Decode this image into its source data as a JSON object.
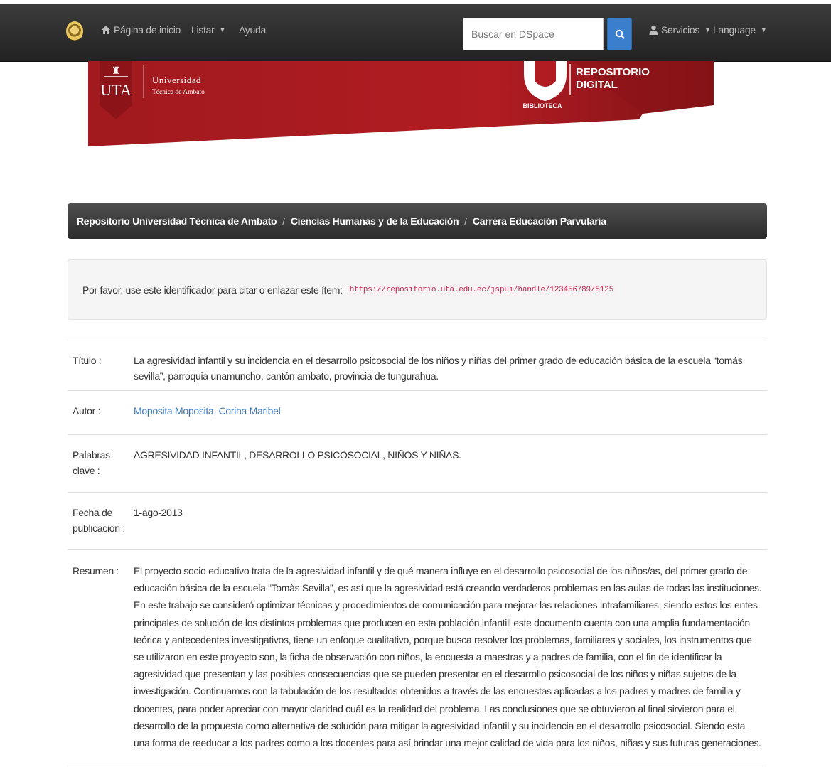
{
  "nav": {
    "home_label": "Página de inicio",
    "list_label": "Listar",
    "help_label": "Ayuda",
    "search_placeholder": "Buscar en DSpace",
    "services_label": "Servicios",
    "language_label": "Language"
  },
  "banner": {
    "uta_short": "UTA",
    "university_line1": "Universidad",
    "university_line2": "Técnica de Ambato",
    "repo_line1": "REPOSITORIO",
    "repo_line2": "DIGITAL",
    "library_label": "BIBLIOTECA",
    "colors": {
      "primary": "#a11a1e",
      "dark": "#6e0f12"
    }
  },
  "breadcrumb": {
    "items": [
      "Repositorio Universidad Técnica de Ambato",
      "Ciencias Humanas y de la Educación",
      "Carrera Educación Parvularia"
    ],
    "separator": "/"
  },
  "cite": {
    "label": "Por favor, use este identificador para citar o enlazar este ítem:",
    "uri": "https://repositorio.uta.edu.ec/jspui/handle/123456789/5125"
  },
  "metadata": {
    "title_label": "Título :",
    "title_value": "La agresividad infantil y su incidencia en el desarrollo psicosocial de los niños y niñas del primer grado de educación básica de la escuela “tomás sevilla”, parroquia unamuncho, cantón ambato, provincia de tungurahua.",
    "author_label": "Autor :",
    "author_value": "Moposita Moposita, Corina Maribel",
    "keywords_label": "Palabras clave :",
    "keywords_value": "AGRESIVIDAD INFANTIL, DESARROLLO PSICOSOCIAL, NIÑOS Y NIÑAS.",
    "date_label": "Fecha de publicación :",
    "date_value": "1-ago-2013",
    "abstract_label": "Resumen :",
    "abstract_value": "El proyecto socio educativo trata de la agresividad infantil y de qué manera influye en el desarrollo psicosocial de los niños/as, del primer grado de educación básica de la escuela “Tomàs Sevilla”, es así que la agresividad está creando verdaderos problemas en las aulas de todas las instituciones. En este trabajo se consideró optimizar técnicas y procedimientos de comunicación para mejorar las relaciones intrafamiliares, siendo estos los entes principales de solución de los distintos problemas que producen en esta población infantill este documento cuenta con una amplia fundamentación teórica y antecedentes investigativos, tiene un enfoque cualitativo, porque busca resolver los problemas, familiares y sociales, los instrumentos que se utilizaron en este proyecto son, la ficha de observación con niños, la encuesta a maestras y a padres de familia, con el fin de identificar la agresividad que presentan y las posibles consecuencias que se pueden presentar en el desarrollo psicosocial de los niños y niñas sujetos de la investigación. Continuamos con la tabulación de los resultados obtenidos a través de las encuestas aplicadas a los padres y madres de familia y docentes, para poder apreciar con mayor claridad cuál es la realidad del problema. Las conclusiones que se obtuvieron al final sirvieron para el desarrollo de la propuesta como alternativa de solución para mitigar la agresividad infantil y su incidencia en el desarrollo psicosocial. Siendo esta una forma de reeducar a los padres como a los docentes para así brindar una mejor calidad de vida para los niños, niñas y sus futuras generaciones."
  }
}
